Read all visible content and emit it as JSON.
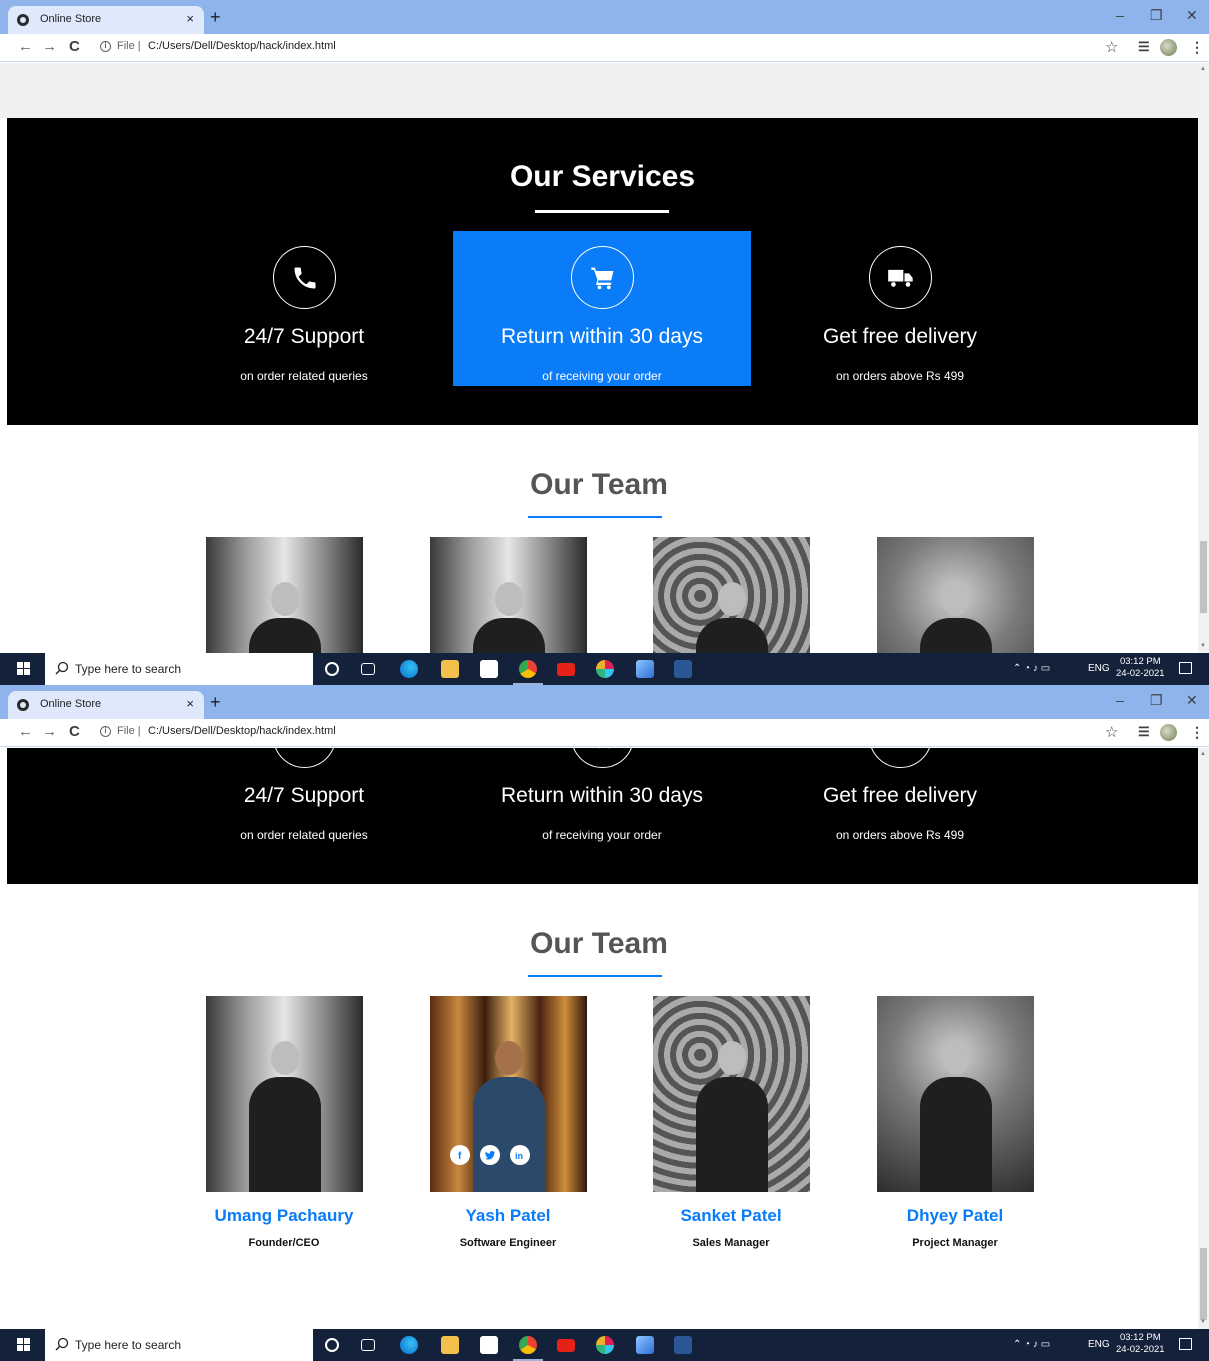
{
  "browser": {
    "tab_title": "Online Store",
    "tab_close": "×",
    "new_tab": "+",
    "win_min": "–",
    "win_restore": "❐",
    "win_close": "✕",
    "nav_back": "←",
    "nav_forward": "→",
    "nav_reload": "C",
    "info": "i",
    "address_scheme": "File |",
    "address_url": "C:/Users/Dell/Desktop/hack/index.html",
    "star": "☆",
    "reading_list": "☰",
    "kebab": "⋮"
  },
  "services": {
    "title": "Our Services",
    "items": [
      {
        "name": "24/7 Support",
        "sub": "on order related queries",
        "icon": "phone-icon"
      },
      {
        "name": "Return within 30 days",
        "sub": "of receiving your order",
        "icon": "cart-icon"
      },
      {
        "name": "Get free delivery",
        "sub": "on orders above Rs 499",
        "icon": "truck-icon"
      }
    ]
  },
  "team": {
    "title": "Our Team",
    "members": [
      {
        "name": "Umang Pachaury",
        "role": "Founder/CEO"
      },
      {
        "name": "Yash Patel",
        "role": "Software Engineer"
      },
      {
        "name": "Sanket Patel",
        "role": "Sales Manager"
      },
      {
        "name": "Dhyey Patel",
        "role": "Project Manager"
      }
    ],
    "social": {
      "facebook": "f",
      "linkedin": "in"
    }
  },
  "taskbar": {
    "search_placeholder": "Type here to search",
    "tray_lang": "ENG",
    "time": "03:12 PM",
    "date": "24-02-2021"
  },
  "colors": {
    "accent": "#0a7cf8",
    "services_bg": "#000000",
    "taskbar": "#14213a"
  }
}
